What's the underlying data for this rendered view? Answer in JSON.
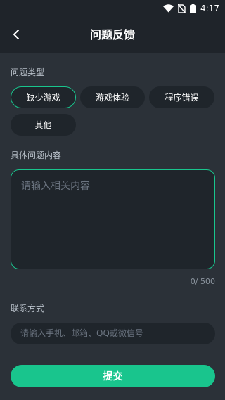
{
  "status_bar": {
    "time": "4:17"
  },
  "header": {
    "title": "问题反馈"
  },
  "problem_type": {
    "label": "问题类型",
    "options": [
      "缺少游戏",
      "游戏体验",
      "程序错误",
      "其他"
    ],
    "selected": "缺少游戏"
  },
  "details": {
    "label": "具体问题内容",
    "placeholder": "请输入相关内容",
    "counter": "0/ 500"
  },
  "contact": {
    "label": "联系方式",
    "placeholder": "请输入手机、邮箱、QQ或微信号"
  },
  "submit_label": "提交",
  "colors": {
    "accent": "#19c58d",
    "background": "#2b3138",
    "bar": "#1f242a",
    "field": "#1f252b"
  }
}
